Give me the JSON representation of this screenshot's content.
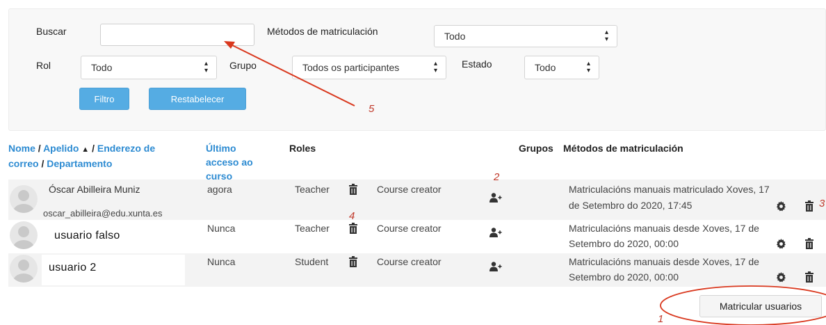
{
  "filters": {
    "search_label": "Buscar",
    "search_value": "",
    "enrol_methods_label": "Métodos de matriculación",
    "enrol_methods_value": "Todo",
    "role_label": "Rol",
    "role_value": "Todo",
    "group_label": "Grupo",
    "group_value": "Todos os participantes",
    "status_label": "Estado",
    "status_value": "Todo",
    "filter_button": "Filtro",
    "reset_button": "Restabelecer"
  },
  "table": {
    "headers": {
      "nome": "Nome",
      "sep1": " / ",
      "apelido": "Apelido",
      "sep2": " / ",
      "enderezo1": "Enderezo de",
      "enderezo2": "correo",
      "sep3": " / ",
      "departamento": "Departamento",
      "ultimo1": "Último",
      "ultimo2": "acceso ao",
      "ultimo3": "curso",
      "roles": "Roles",
      "grupos": "Grupos",
      "metodos": "Métodos de matriculación"
    },
    "rows": [
      {
        "name": "Óscar Abilleira Muniz",
        "email": "oscar_abilleira@edu.xunta.es",
        "last_access": "agora",
        "role": "Teacher",
        "second_role": "Course creator",
        "method_line1": "Matriculacións manuais matriculado Xoves, 17",
        "method_line2": "de Setembro do 2020, 17:45"
      },
      {
        "name": "usuario falso",
        "last_access": "Nunca",
        "role": "Teacher",
        "second_role": "Course creator",
        "method_line1": "Matriculacións manuais desde Xoves, 17 de",
        "method_line2": "Setembro do 2020, 00:00"
      },
      {
        "name": "usuario 2",
        "last_access": "Nunca",
        "role": "Student",
        "second_role": "Course creator",
        "method_line1": "Matriculacións manuais desde Xoves, 17 de",
        "method_line2": "Setembro do 2020, 00:00"
      }
    ]
  },
  "enrol_button": "Matricular usuarios",
  "annotations": {
    "n1": "1",
    "n2": "2",
    "n3": "3",
    "n4": "4",
    "n5": "5",
    "color": "#d9381e"
  },
  "colors": {
    "link": "#2d8bd2",
    "button_blue": "#55ace3"
  },
  "icons": [
    "chevron-up-icon",
    "trash-icon",
    "gear-icon",
    "add-user-icon",
    "user-avatar-icon",
    "select-caret-icon"
  ]
}
